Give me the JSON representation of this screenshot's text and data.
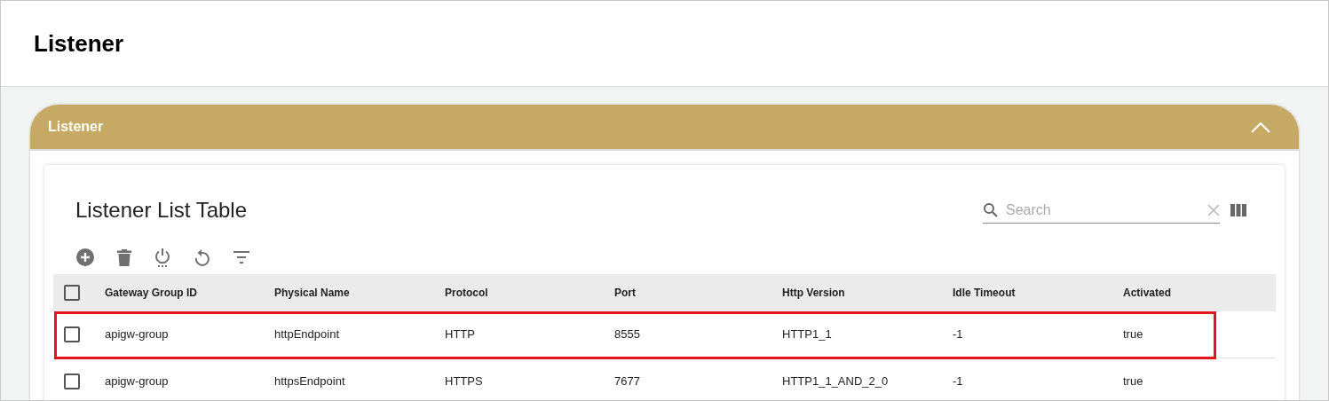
{
  "page_title": "Listener",
  "panel": {
    "title": "Listener",
    "expanded": true
  },
  "table": {
    "title": "Listener List Table",
    "search": {
      "placeholder": "Search"
    },
    "select_all": {
      "checked": false
    },
    "columns": [
      "Gateway Group ID",
      "Physical Name",
      "Protocol",
      "Port",
      "Http Version",
      "Idle Timeout",
      "Activated"
    ],
    "rows": [
      {
        "checked": false,
        "highlighted": true,
        "cells": [
          "apigw-group",
          "httpEndpoint",
          "HTTP",
          "8555",
          "HTTP1_1",
          "-1",
          "true"
        ]
      },
      {
        "checked": false,
        "highlighted": false,
        "cells": [
          "apigw-group",
          "httpsEndpoint",
          "HTTPS",
          "7677",
          "HTTP1_1_AND_2_0",
          "-1",
          "true"
        ]
      }
    ]
  }
}
